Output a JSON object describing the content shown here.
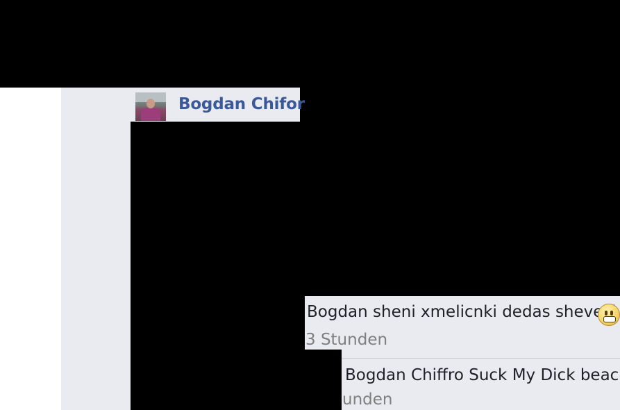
{
  "post": {
    "author_name": "Bogdan Chifor"
  },
  "comments": [
    {
      "text": "Bogdan sheni xmelicnki dedas sheveci",
      "emoticon": "smile-emoji",
      "time": "3 Stunden"
    },
    {
      "text": "Bogdan Chiffro Suck My Dick beach",
      "time": "unden"
    }
  ],
  "colors": {
    "panel_bg": "#e9ebf0",
    "name_blue": "#3b5998",
    "meta_gray": "#7f7f7f",
    "redaction": "#000000"
  }
}
